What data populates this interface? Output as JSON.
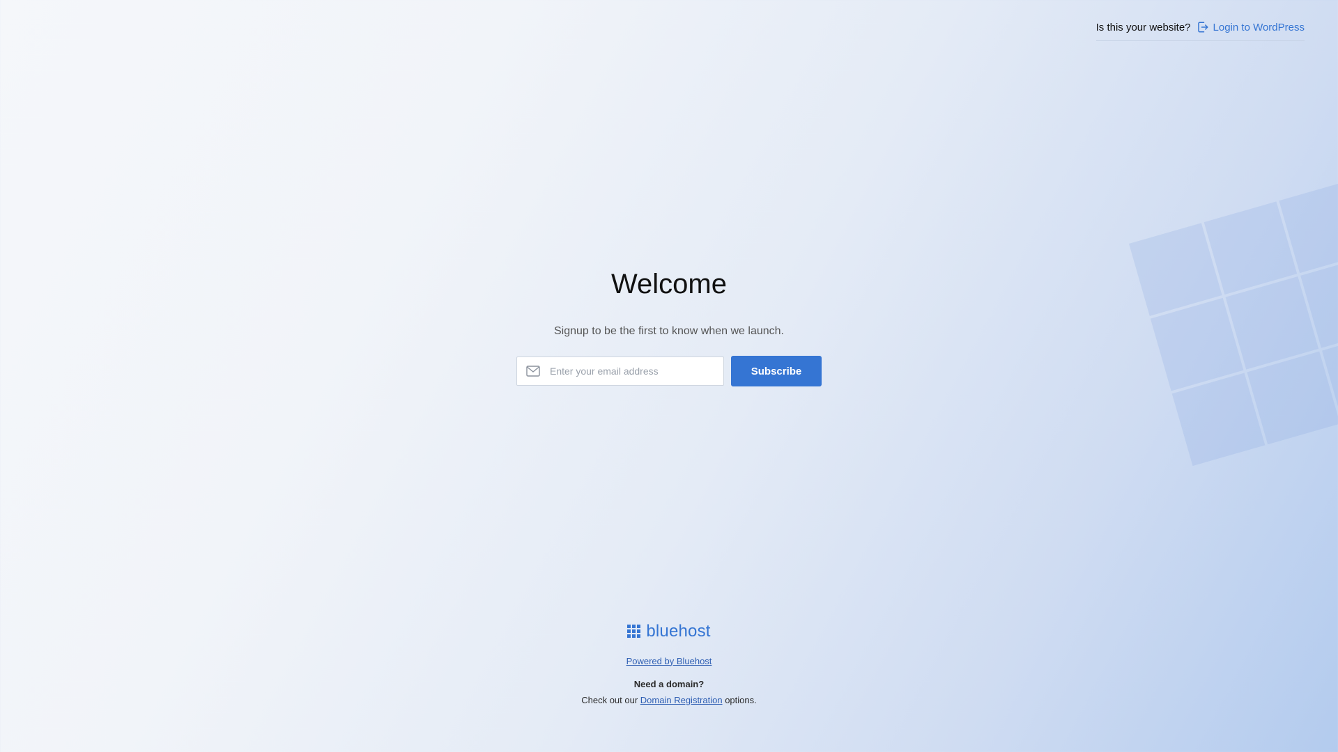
{
  "topbar": {
    "question": "Is this your website?",
    "login_label": "Login to WordPress"
  },
  "main": {
    "title": "Welcome",
    "subtitle": "Signup to be the first to know when we launch.",
    "email_placeholder": "Enter your email address",
    "email_value": "",
    "subscribe_label": "Subscribe"
  },
  "footer": {
    "logo_text": "bluehost",
    "powered_label": "Powered by Bluehost",
    "need_domain": "Need a domain?",
    "check_prefix": "Check out our",
    "domain_link": "Domain Registration",
    "check_suffix": "options."
  },
  "colors": {
    "accent": "#3575d3",
    "link": "#2f5fb3"
  },
  "icons": {
    "login": "login-icon",
    "email": "mail-icon",
    "logo": "bluehost-grid-icon"
  }
}
